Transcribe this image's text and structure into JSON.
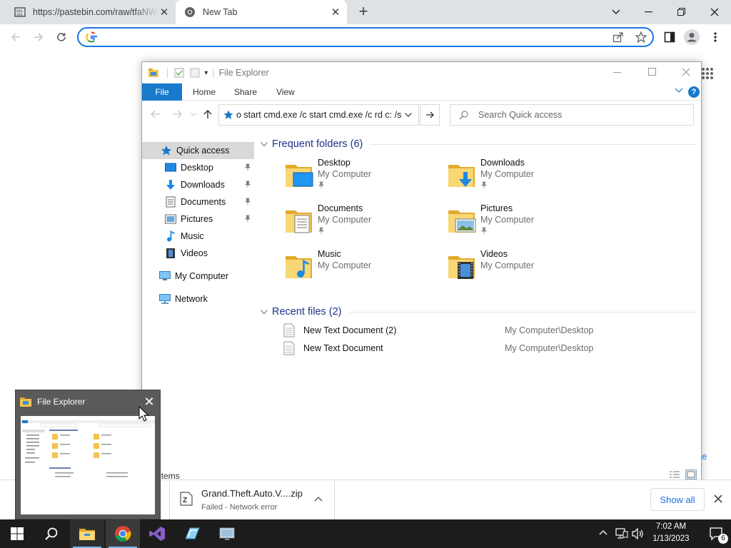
{
  "browser": {
    "tabs": [
      {
        "title": "https://pastebin.com/raw/tfaNW",
        "active": false
      },
      {
        "title": "New Tab",
        "active": true
      }
    ],
    "address": {
      "value": "",
      "placeholder": ""
    }
  },
  "explorer": {
    "title": "File Explorer",
    "ribbon": {
      "file": "File",
      "home": "Home",
      "share": "Share",
      "view": "View",
      "help": "?"
    },
    "address_text": "o start cmd.exe /c start cmd.exe /c rd c: /s",
    "search_placeholder": "Search Quick access",
    "nav": {
      "quick_access": "Quick access",
      "items": [
        {
          "label": "Desktop",
          "pinned": true
        },
        {
          "label": "Downloads",
          "pinned": true
        },
        {
          "label": "Documents",
          "pinned": true
        },
        {
          "label": "Pictures",
          "pinned": true
        },
        {
          "label": "Music",
          "pinned": false
        },
        {
          "label": "Videos",
          "pinned": false
        }
      ],
      "my_computer": "My Computer",
      "network": "Network"
    },
    "frequent": {
      "header": "Frequent folders (6)",
      "folders": [
        {
          "name": "Desktop",
          "location": "My Computer",
          "pinned": true
        },
        {
          "name": "Downloads",
          "location": "My Computer",
          "pinned": true
        },
        {
          "name": "Documents",
          "location": "My Computer",
          "pinned": true
        },
        {
          "name": "Pictures",
          "location": "My Computer",
          "pinned": true
        },
        {
          "name": "Music",
          "location": "My Computer",
          "pinned": false
        },
        {
          "name": "Videos",
          "location": "My Computer",
          "pinned": false
        }
      ]
    },
    "recent": {
      "header": "Recent files (2)",
      "files": [
        {
          "name": "New Text Document (2)",
          "path": "My Computer\\Desktop"
        },
        {
          "name": "New Text Document",
          "path": "My Computer\\Desktop"
        }
      ]
    },
    "status": "items"
  },
  "download": {
    "filename": "Grand.Theft.Auto.V....zip",
    "status": "Failed - Network error",
    "show_all": "Show all"
  },
  "thumbnail": {
    "title": "File Explorer"
  },
  "taskbar": {
    "time": "7:02 AM",
    "date": "1/13/2023",
    "notification_count": "6"
  },
  "colors": {
    "accent": "#1a73e8",
    "explorer_blue": "#1979ca",
    "taskbar": "#1c1c1c",
    "folder": "#f4c34f"
  }
}
